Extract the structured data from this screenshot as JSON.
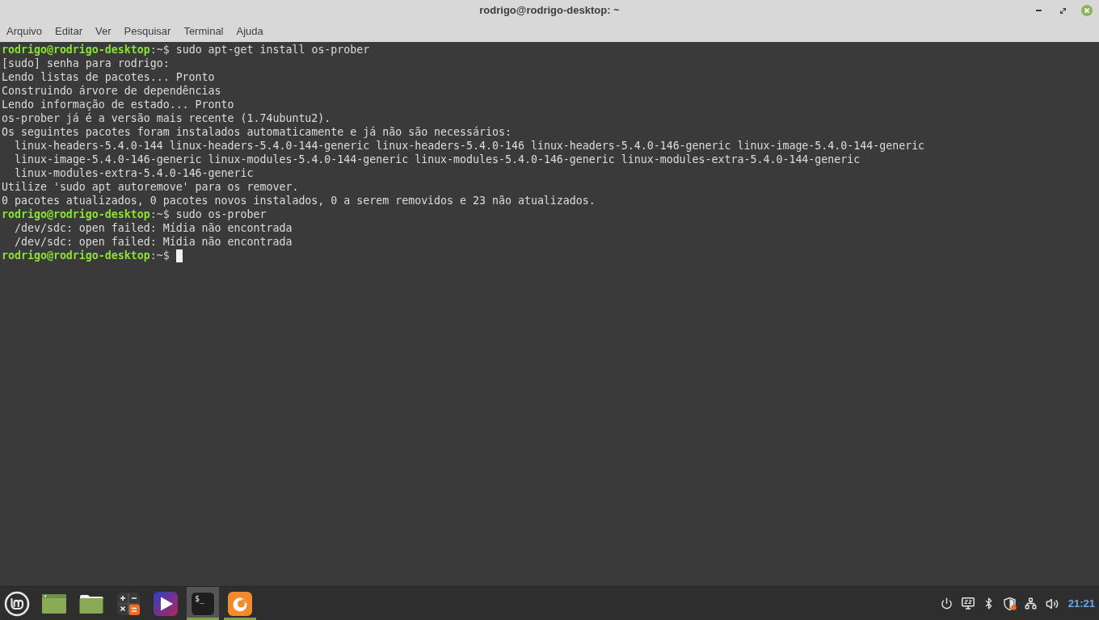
{
  "window": {
    "title": "rodrigo@rodrigo-desktop: ~"
  },
  "menu": [
    "Arquivo",
    "Editar",
    "Ver",
    "Pesquisar",
    "Terminal",
    "Ajuda"
  ],
  "terminal": {
    "lines": [
      {
        "kind": "prompt",
        "user_host": "rodrigo@rodrigo-desktop",
        "suffix": ":~$",
        "command": "sudo apt-get install os-prober",
        "cursor": false
      },
      {
        "kind": "output",
        "text": "[sudo] senha para rodrigo:"
      },
      {
        "kind": "output",
        "text": "Lendo listas de pacotes... Pronto"
      },
      {
        "kind": "output",
        "text": "Construindo árvore de dependências"
      },
      {
        "kind": "output",
        "text": "Lendo informação de estado... Pronto"
      },
      {
        "kind": "output",
        "text": "os-prober já é a versão mais recente (1.74ubuntu2)."
      },
      {
        "kind": "output",
        "text": "Os seguintes pacotes foram instalados automaticamente e já não são necessários:"
      },
      {
        "kind": "indented",
        "text": "linux-headers-5.4.0-144 linux-headers-5.4.0-144-generic linux-headers-5.4.0-146 linux-headers-5.4.0-146-generic linux-image-5.4.0-144-generic"
      },
      {
        "kind": "indented",
        "text": "linux-image-5.4.0-146-generic linux-modules-5.4.0-144-generic linux-modules-5.4.0-146-generic linux-modules-extra-5.4.0-144-generic"
      },
      {
        "kind": "indented",
        "text": "linux-modules-extra-5.4.0-146-generic"
      },
      {
        "kind": "output",
        "text": "Utilize 'sudo apt autoremove' para os remover."
      },
      {
        "kind": "output",
        "text": "0 pacotes atualizados, 0 pacotes novos instalados, 0 a serem removidos e 23 não atualizados."
      },
      {
        "kind": "prompt",
        "user_host": "rodrigo@rodrigo-desktop",
        "suffix": ":~$",
        "command": "sudo os-prober",
        "cursor": false
      },
      {
        "kind": "indented",
        "text": "/dev/sdc: open failed: Mídia não encontrada"
      },
      {
        "kind": "indented",
        "text": "/dev/sdc: open failed: Mídia não encontrada"
      },
      {
        "kind": "prompt",
        "user_host": "rodrigo@rodrigo-desktop",
        "suffix": ":~$",
        "cursor": true
      }
    ]
  },
  "taskbar": {
    "launchers": [
      {
        "kind": "menu",
        "running": false,
        "focused": false
      },
      {
        "kind": "files-window",
        "running": false,
        "focused": false
      },
      {
        "kind": "folder",
        "running": false,
        "focused": false
      },
      {
        "kind": "calculator",
        "running": false,
        "focused": false
      },
      {
        "kind": "media-player",
        "running": false,
        "focused": false
      },
      {
        "kind": "terminal",
        "glyph": "$_",
        "running": true,
        "focused": true
      },
      {
        "kind": "browser",
        "running": true,
        "focused": false
      }
    ],
    "clock": "21:21"
  }
}
